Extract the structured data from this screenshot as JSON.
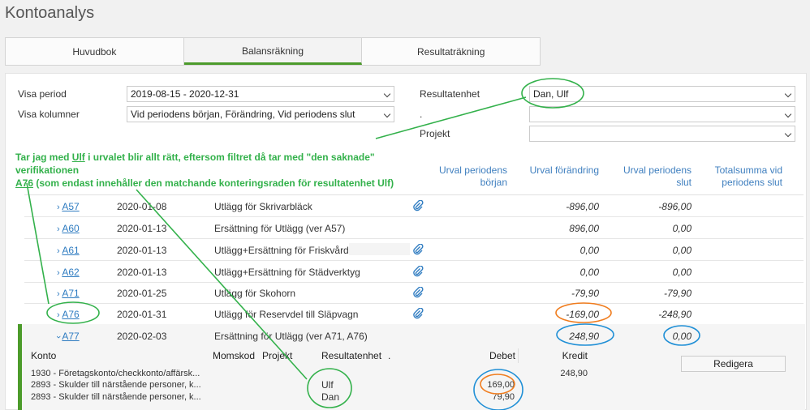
{
  "page": {
    "title": "Kontoanalys"
  },
  "tabs": [
    {
      "label": "Huvudbok"
    },
    {
      "label": "Balansräkning"
    },
    {
      "label": "Resultaträkning"
    }
  ],
  "filters": {
    "period_label": "Visa period",
    "period_value": "2019-08-15 - 2020-12-31",
    "columns_label": "Visa kolumner",
    "columns_value": "Vid periodens början, Förändring, Vid periodens slut",
    "unit_label": "Resultatenhet",
    "unit_value": "Dan, Ulf",
    "dot_label": ".",
    "dot_value": "",
    "project_label": "Projekt",
    "project_value": ""
  },
  "annotation": {
    "line1_pre": "Tar jag med ",
    "line1_ulf": "Ulf",
    "line1_post": " i urvalet blir allt rätt, eftersom filtret då tar med \"den saknade\" verifikationen",
    "line2_a76": "A76",
    "line2_post": " (som endast innehåller den matchande konteringsraden för resultatenhet Ulf)"
  },
  "columns": {
    "start": "Urval periodens början",
    "change": "Urval förändring",
    "end": "Urval periodens slut",
    "total": "Totalsumma vid periodens slut"
  },
  "rows": [
    {
      "ver": "A57",
      "date": "2020-01-08",
      "text": "Utlägg för Skrivarbläck",
      "attach": true,
      "change": "-896,00",
      "end": "-896,00"
    },
    {
      "ver": "A60",
      "date": "2020-01-13",
      "text": "Ersättning för Utlägg (ver A57)",
      "attach": false,
      "change": "896,00",
      "end": "0,00"
    },
    {
      "ver": "A61",
      "date": "2020-01-13",
      "text": "Utlägg+Ersättning för Friskvård",
      "attach": true,
      "change": "0,00",
      "end": "0,00"
    },
    {
      "ver": "A62",
      "date": "2020-01-13",
      "text": "Utlägg+Ersättning för Städverktyg",
      "attach": true,
      "change": "0,00",
      "end": "0,00"
    },
    {
      "ver": "A71",
      "date": "2020-01-25",
      "text": "Utlägg för Skohorn",
      "attach": true,
      "change": "-79,90",
      "end": "-79,90"
    },
    {
      "ver": "A76",
      "date": "2020-01-31",
      "text": "Utlägg för Reservdel till Släpvagn",
      "attach": true,
      "change": "-169,00",
      "end": "-248,90"
    },
    {
      "ver": "A77",
      "date": "2020-02-03",
      "text": "Ersättning för Utlägg (ver A71, A76)",
      "attach": false,
      "change": "248,90",
      "end": "0,00"
    }
  ],
  "detail": {
    "headers": {
      "konto": "Konto",
      "moms": "Momskod",
      "projekt": "Projekt",
      "enhet": "Resultatenhet",
      "dot": ".",
      "debet": "Debet",
      "kredit": "Kredit"
    },
    "lines": [
      {
        "konto": "1930 - Företagskonto/checkkonto/affärsk...",
        "enhet": "",
        "debet": "",
        "kredit": "248,90"
      },
      {
        "konto": "2893 - Skulder till närstående personer, k...",
        "enhet": "Ulf",
        "debet": "169,00",
        "kredit": ""
      },
      {
        "konto": "2893 - Skulder till närstående personer, k...",
        "enhet": "Dan",
        "debet": "79,90",
        "kredit": ""
      }
    ],
    "edit_button": "Redigera"
  },
  "colors": {
    "accent_green": "#4c9b2b",
    "annotation_green": "#33b14b",
    "circle_orange": "#f07d1f",
    "circle_blue": "#1f8fd6",
    "link_blue": "#2f7cc1"
  }
}
